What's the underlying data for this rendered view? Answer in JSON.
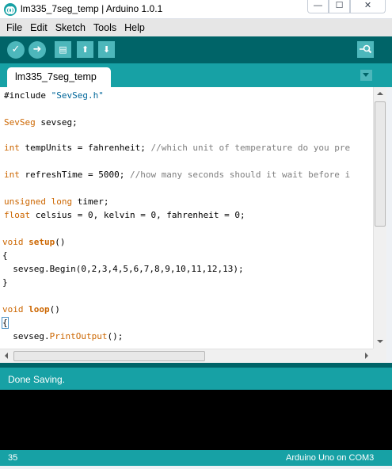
{
  "window": {
    "title": "lm335_7seg_temp | Arduino 1.0.1",
    "minimize_glyph": "—",
    "maximize_glyph": "☐",
    "close_glyph": "✕"
  },
  "menu": {
    "items": [
      "File",
      "Edit",
      "Sketch",
      "Tools",
      "Help"
    ]
  },
  "toolbar": {
    "buttons": [
      {
        "name": "verify",
        "icon": "check-icon",
        "glyph": "✓"
      },
      {
        "name": "upload",
        "icon": "arrow-right-icon",
        "glyph": "➜"
      },
      {
        "name": "new",
        "icon": "new-file-icon",
        "glyph": "▤"
      },
      {
        "name": "open",
        "icon": "arrow-up-icon",
        "glyph": "⬆"
      },
      {
        "name": "save",
        "icon": "arrow-down-icon",
        "glyph": "⬇"
      },
      {
        "name": "serial-monitor",
        "icon": "magnifier-icon"
      }
    ]
  },
  "tabs": [
    {
      "label": "lm335_7seg_temp"
    }
  ],
  "editor": {
    "lines": [
      "#include \"SevSeg.h\"",
      "",
      "SevSeg sevseg;",
      "",
      "int tempUnits = fahrenheit; //which unit of temperature do you pre",
      "",
      "int refreshTime = 5000; //how many seconds should it wait before i",
      "",
      "unsigned long timer;",
      "float celsius = 0, kelvin = 0, fahrenheit = 0;",
      "",
      "void setup()",
      "{",
      "  sevseg.Begin(0,2,3,4,5,6,7,8,9,10,11,12,13);",
      "}",
      "",
      "void loop()",
      "{",
      "  sevseg.PrintOutput();"
    ]
  },
  "status": {
    "message": "Done Saving."
  },
  "footer": {
    "line_number": "35",
    "board": "Arduino Uno on COM3"
  },
  "colors": {
    "toolbar_bg": "#006468",
    "accent": "#17a1a5",
    "button": "#4db7bb",
    "keyword": "#cc6600",
    "string": "#006699",
    "comment": "#7e7e7e",
    "console_bg": "#000000"
  }
}
